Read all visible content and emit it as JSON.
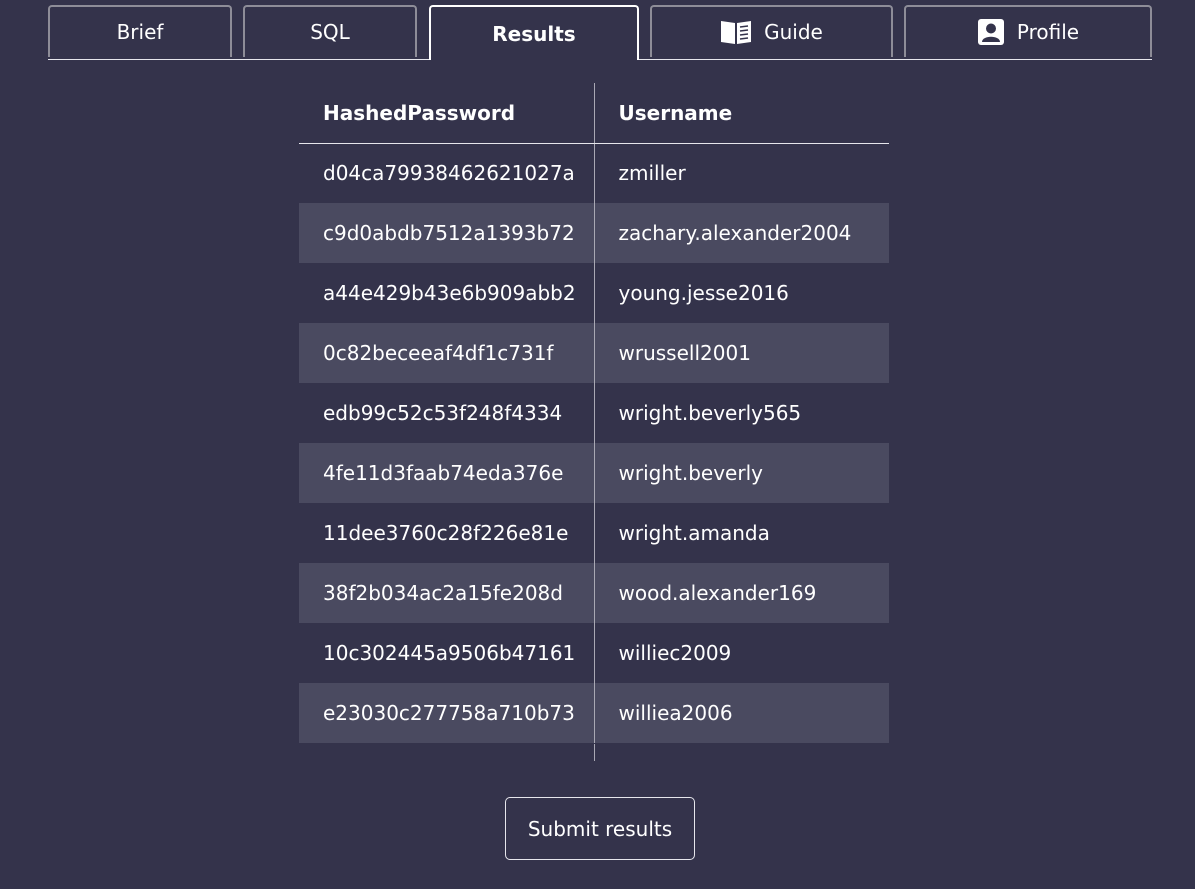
{
  "tabs": [
    {
      "label": "Brief",
      "icon": null,
      "active": false
    },
    {
      "label": "SQL",
      "icon": null,
      "active": false
    },
    {
      "label": "Results",
      "icon": null,
      "active": true
    },
    {
      "label": "Guide",
      "icon": "book-icon",
      "active": false
    },
    {
      "label": "Profile",
      "icon": "user-card-icon",
      "active": false
    }
  ],
  "table": {
    "columns": [
      "HashedPassword",
      "Username"
    ],
    "rows": [
      [
        "d04ca79938462621027a",
        "zmiller"
      ],
      [
        "c9d0abdb7512a1393b72",
        "zachary.alexander2004"
      ],
      [
        "a44e429b43e6b909abb2",
        "young.jesse2016"
      ],
      [
        "0c82beceeaf4df1c731f",
        "wrussell2001"
      ],
      [
        "edb99c52c53f248f4334",
        "wright.beverly565"
      ],
      [
        "4fe11d3faab74eda376e",
        "wright.beverly"
      ],
      [
        "11dee3760c28f226e81e",
        "wright.amanda"
      ],
      [
        "38f2b034ac2a15fe208d",
        "wood.alexander169"
      ],
      [
        "10c302445a9506b47161",
        "williec2009"
      ],
      [
        "e23030c277758a710b73",
        "williea2006"
      ]
    ]
  },
  "submit_label": "Submit results",
  "colors": {
    "background": "#34334b",
    "striped_row": "#4a4a60",
    "tab_border": "#8e8d98",
    "active_border": "#ffffff"
  }
}
